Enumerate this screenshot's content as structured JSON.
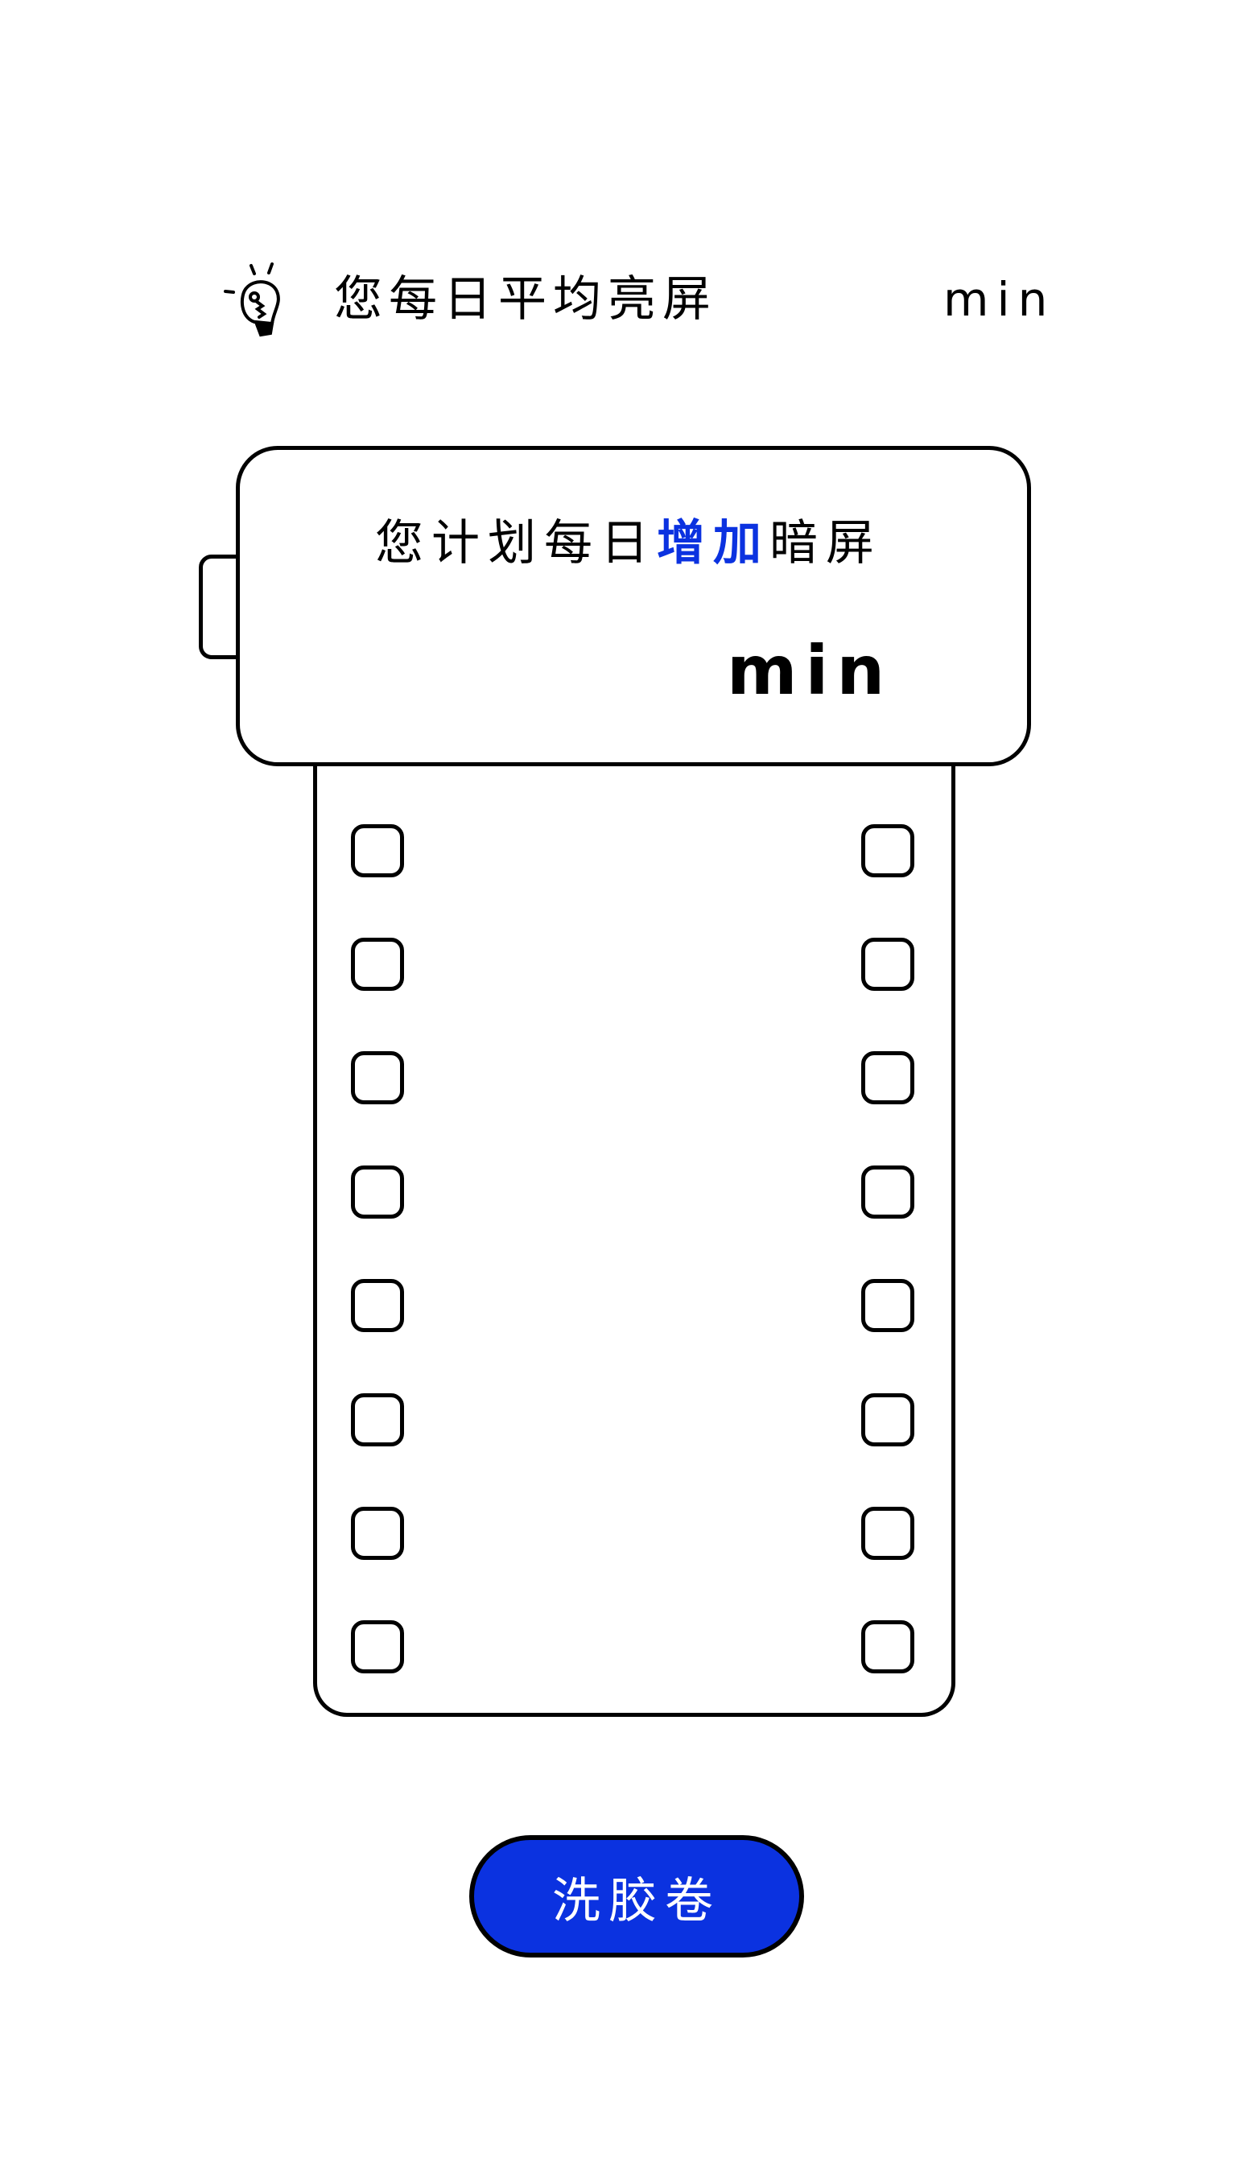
{
  "header": {
    "icon": "lightbulb-icon",
    "label": "您每日平均亮屏",
    "unit": "min"
  },
  "card": {
    "label_prefix": "您计划每日",
    "label_highlight": "增加",
    "label_suffix": "暗屏",
    "unit": "min",
    "highlight_color": "#0b32e0"
  },
  "film": {
    "holes_per_side": 8
  },
  "button": {
    "label": "洗胶卷",
    "color": "#0b32e0"
  }
}
